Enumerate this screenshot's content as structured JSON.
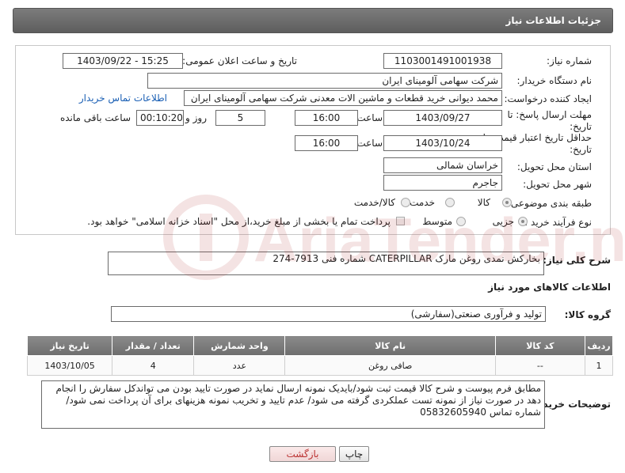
{
  "header": {
    "title": "جزئیات اطلاعات نیاز"
  },
  "form": {
    "need_number_label": "شماره نیاز:",
    "need_number": "1103001491001938",
    "announce_label": "تاریخ و ساعت اعلان عمومی:",
    "announce_value": "1403/09/22 - 15:25",
    "buyer_org_label": "نام دستگاه خریدار:",
    "buyer_org": "شرکت سهامی آلومینای ایران",
    "requester_label": "ایجاد کننده درخواست:",
    "requester": "محمد دیوانی خرید قطعات و ماشین الات معدنی شرکت سهامی آلومینای ایران",
    "contact_link": "اطلاعات تماس خریدار",
    "deadline_label_1": "مهلت ارسال پاسخ: تا",
    "deadline_label_2": "تاریخ:",
    "deadline_date": "1403/09/27",
    "time_word": "ساعت",
    "deadline_time": "16:00",
    "days_value": "5",
    "days_word": "روز و",
    "remaining_time": "00:10:20",
    "remaining_word": "ساعت باقی مانده",
    "validity_label_1": "حداقل تاریخ اعتبار قیمت: تا",
    "validity_label_2": "تاریخ:",
    "validity_date": "1403/10/24",
    "validity_time": "16:00",
    "province_label": "استان محل تحویل:",
    "province": "خراسان شمالی",
    "city_label": "شهر محل تحویل:",
    "city": "جاجرم",
    "category_label": "طبقه بندی موضوعی:",
    "category_options": [
      "کالا",
      "خدمت",
      "کالا/خدمت"
    ],
    "process_label": "نوع فرآیند خرید :",
    "process_options": [
      "جزیی",
      "متوسط"
    ],
    "payment_note": "پرداخت تمام یا بخشی از مبلغ خرید،از محل \"اسناد خزانه اسلامی\" خواهد بود."
  },
  "summary": {
    "label": "شرح کلی نیاز:",
    "text": "بخارکش نمدی روغن مارک CATERPILLAR شماره فنی 7913-274"
  },
  "goods_info_title": "اطلاعات کالاهای مورد نیاز",
  "goods_group": {
    "label": "گروه کالا:",
    "value": "تولید و فرآوری صنعتی(سفارشی)"
  },
  "table": {
    "headers": [
      "ردیف",
      "کد کالا",
      "نام کالا",
      "واحد شمارش",
      "تعداد / مقدار",
      "تاریخ نیاز"
    ],
    "rows": [
      [
        "1",
        "--",
        "صافی روغن",
        "عدد",
        "4",
        "1403/10/05"
      ]
    ]
  },
  "buyer_notes": {
    "label": "توضیحات خریدار:",
    "text": "مطابق فرم پیوست و شرح کالا قیمت ثبت شود/بایدیک نمونه ارسال نماید در صورت تایید بودن می تواندکل سفارش را انجام دهد در صورت نیاز از نمونه تست عملکردی گرفته می شود/ عدم تایید و تخریب نمونه هزینهای برای آن پرداخت نمی شود/ شماره تماس 05832605940"
  },
  "buttons": {
    "print": "چاپ",
    "back": "بازگشت"
  },
  "watermark": {
    "text": "AriaTender.neT"
  }
}
